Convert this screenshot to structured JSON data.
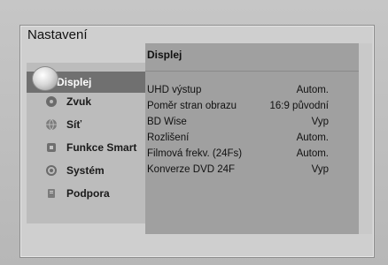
{
  "app": {
    "title": "Nastavení"
  },
  "sidebar": {
    "items": [
      {
        "label": "Displej",
        "icon": "display-icon",
        "selected": true
      },
      {
        "label": "Zvuk",
        "icon": "speaker-icon",
        "selected": false
      },
      {
        "label": "Síť",
        "icon": "globe-icon",
        "selected": false
      },
      {
        "label": "Funkce Smart",
        "icon": "smart-icon",
        "selected": false
      },
      {
        "label": "Systém",
        "icon": "gear-icon",
        "selected": false
      },
      {
        "label": "Podpora",
        "icon": "support-icon",
        "selected": false
      }
    ]
  },
  "panel": {
    "header": "Displej",
    "rows": [
      {
        "label": "UHD výstup",
        "value": "Autom."
      },
      {
        "label": "Poměr stran obrazu",
        "value": "16:9 původní"
      },
      {
        "label": "BD Wise",
        "value": "Vyp"
      },
      {
        "label": "Rozlišení",
        "value": "Autom."
      },
      {
        "label": "Filmová frekv. (24Fs)",
        "value": "Autom."
      },
      {
        "label": "Konverze DVD 24F",
        "value": "Vyp"
      }
    ]
  },
  "colors": {
    "background": "#bdbdbd",
    "panel": "#a0a0a0",
    "selected": "#707070"
  }
}
